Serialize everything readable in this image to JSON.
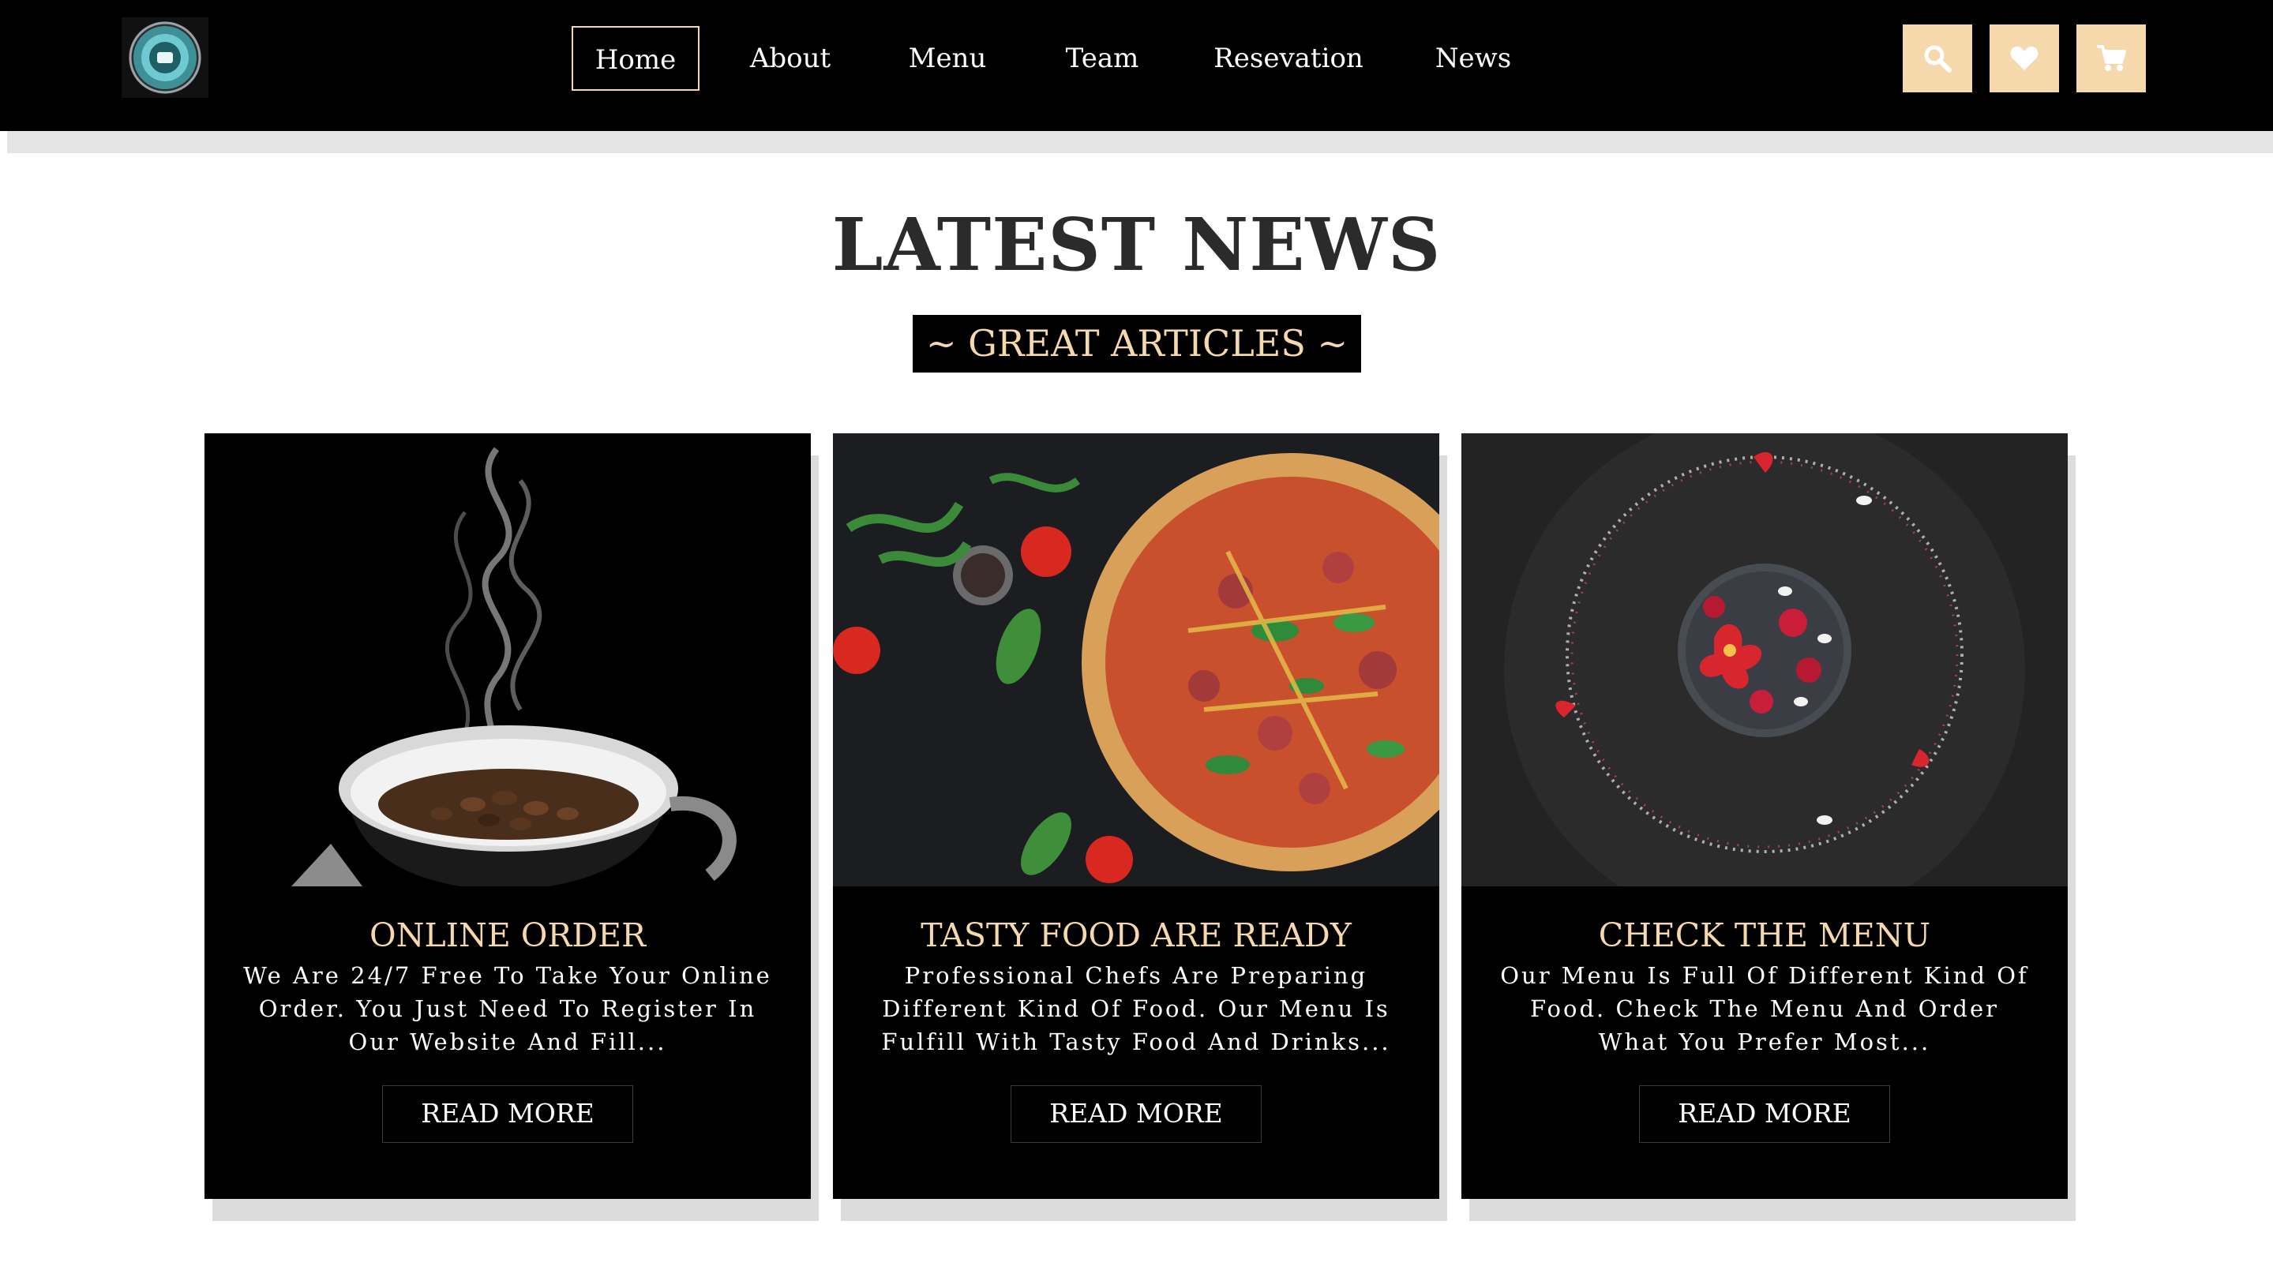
{
  "header": {
    "logo_icon": "restaurant-logo-icon",
    "nav": [
      {
        "label": "Home",
        "active": true
      },
      {
        "label": "About",
        "active": false
      },
      {
        "label": "Menu",
        "active": false
      },
      {
        "label": "Team",
        "active": false
      },
      {
        "label": "Resevation",
        "active": false
      },
      {
        "label": "News",
        "active": false
      }
    ],
    "icons": [
      "search-icon",
      "heart-icon",
      "cart-icon"
    ]
  },
  "section": {
    "title": "LATEST NEWS",
    "subtitle": "~ GREAT ARTICLES ~"
  },
  "cards": [
    {
      "image_icon": "coffee-cup-image",
      "title": "ONLINE ORDER",
      "text": "We Are 24/7 Free To Take Your Online Order. You Just Need To Register In Our Website And Fill...",
      "button": "READ MORE"
    },
    {
      "image_icon": "pizza-image",
      "title": "TASTY FOOD ARE READY",
      "text": "Professional Chefs Are Preparing Different Kind Of Food. Our Menu Is Fulfill With Tasty Food And Drinks...",
      "button": "READ MORE"
    },
    {
      "image_icon": "plated-dish-image",
      "title": "CHECK THE MENU",
      "text": "Our Menu Is Full Of Different Kind Of Food. Check The Menu And Order What You Prefer Most...",
      "button": "READ MORE"
    }
  ],
  "colors": {
    "accent": "#f5d9ad",
    "header_bg": "#000000",
    "card_bg": "#000000",
    "heading": "#2b2b2b"
  }
}
